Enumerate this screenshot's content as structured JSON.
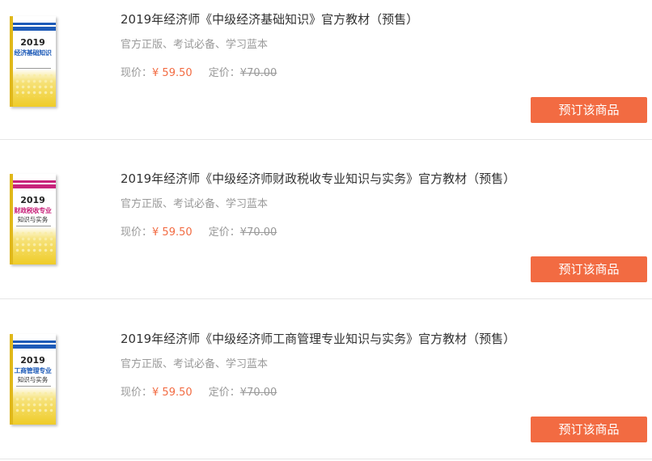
{
  "products": [
    {
      "title": "2019年经济师《中级经济基础知识》官方教材（预售）",
      "subtitle": "官方正版、考试必备、学习蓝本",
      "price_label": "现价：",
      "price": "¥ 59.50",
      "original_label": "定价：",
      "original_price": "¥70.00",
      "button": "预订该商品",
      "cover": {
        "year": "2019",
        "line1": "经济基础知识",
        "line2": "",
        "accent": "#1e5bb8",
        "badge": "中级"
      }
    },
    {
      "title": "2019年经济师《中级经济师财政税收专业知识与实务》官方教材（预售）",
      "subtitle": "官方正版、考试必备、学习蓝本",
      "price_label": "现价：",
      "price": "¥ 59.50",
      "original_label": "定价：",
      "original_price": "¥70.00",
      "button": "预订该商品",
      "cover": {
        "year": "2019",
        "line1": "财政税收专业",
        "line2": "知识与实务",
        "accent": "#c8237b",
        "badge": "中级"
      }
    },
    {
      "title": "2019年经济师《中级经济师工商管理专业知识与实务》官方教材（预售）",
      "subtitle": "官方正版、考试必备、学习蓝本",
      "price_label": "现价：",
      "price": "¥ 59.50",
      "original_label": "定价：",
      "original_price": "¥70.00",
      "button": "预订该商品",
      "cover": {
        "year": "2019",
        "line1": "工商管理专业",
        "line2": "知识与实务",
        "accent": "#1e5bb8",
        "badge": "中级"
      }
    }
  ],
  "colors": {
    "accent": "#f26b42",
    "muted": "#999999",
    "text": "#333333",
    "divider": "#e6e6e6"
  }
}
